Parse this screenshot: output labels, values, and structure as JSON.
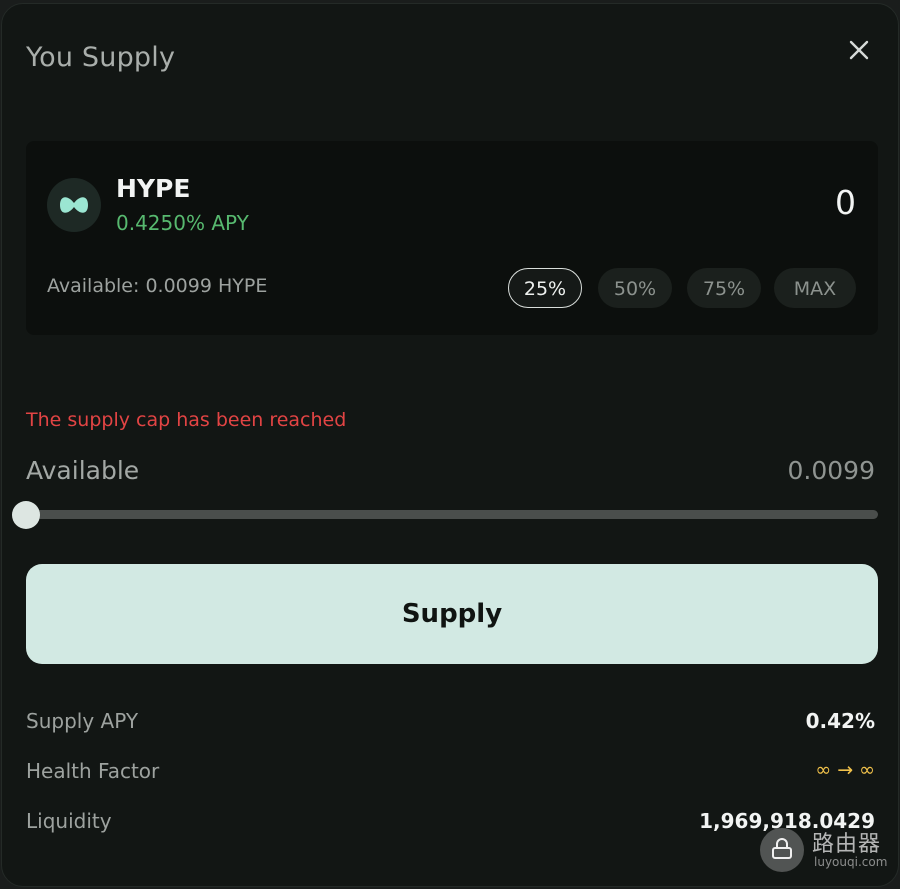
{
  "modal": {
    "title": "You Supply",
    "close_icon": "close-icon"
  },
  "asset": {
    "logo_icon": "hype-token-icon",
    "name": "HYPE",
    "apy": "0.4250% APY",
    "amount_value": "0",
    "available_text": "Available: 0.0099 HYPE",
    "percent_buttons": [
      {
        "label": "25%",
        "active": true
      },
      {
        "label": "50%",
        "active": false
      },
      {
        "label": "75%",
        "active": false
      },
      {
        "label": "MAX",
        "active": false
      }
    ]
  },
  "warning": {
    "text": "The supply cap has been reached"
  },
  "available_bar": {
    "label": "Available",
    "value": "0.0099",
    "slider_fraction": 0.0
  },
  "supply_button": {
    "label": "Supply"
  },
  "details": [
    {
      "label": "Supply APY",
      "value": "0.42%"
    },
    {
      "label": "Health Factor",
      "value": "∞ → ∞"
    },
    {
      "label": "Liquidity",
      "value": "1,969,918.0429"
    }
  ],
  "watermark": {
    "text": "路由器",
    "url": "luyouqi.com"
  },
  "colors": {
    "accent_button": "#d2e9e3",
    "apy_green": "#57b96f",
    "warning_red": "#e24444",
    "health_factor_gold": "#f1c24b"
  }
}
